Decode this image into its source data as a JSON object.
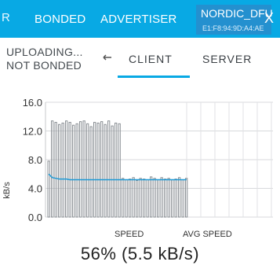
{
  "topbar": {
    "left_edge": "R",
    "tabs": [
      "BONDED",
      "ADVERTISER"
    ],
    "device_name": "NORDIC_DFU",
    "device_mac": "E1:F8:94:9D:A4:AE",
    "close": "X"
  },
  "status": {
    "line1": "UPLOADING...",
    "line2": "NOT BONDED"
  },
  "connection_tabs": {
    "client": "CLIENT",
    "server": "SERVER"
  },
  "speed_text": "56% (5.5 kB/s)",
  "chart_data": {
    "type": "bar",
    "ylabel": "kB/s",
    "ylim": [
      0,
      16
    ],
    "yticks": [
      "16.0",
      "12.0",
      "8.0",
      "4.0",
      "0.0"
    ],
    "series": [
      {
        "name": "SPEED",
        "values": [
          7.8,
          13.4,
          13.2,
          12.9,
          13.1,
          13.4,
          13.2,
          12.8,
          13.0,
          13.3,
          13.4,
          13.0,
          12.6,
          13.2,
          13.1,
          13.3,
          12.9,
          13.4,
          12.7,
          13.1,
          13.0,
          5.4,
          5.2,
          5.3,
          5.5,
          5.1,
          5.4,
          5.3,
          5.2,
          5.6,
          5.4,
          5.2,
          5.5,
          5.3,
          5.4,
          5.2,
          5.3,
          5.5,
          5.2,
          5.4
        ]
      },
      {
        "name": "AVG SPEED",
        "values": [
          6.0,
          5.5,
          5.4,
          5.3,
          5.3,
          5.3,
          5.2,
          5.2,
          5.2,
          5.2,
          5.2,
          5.2,
          5.2,
          5.2,
          5.2,
          5.2,
          5.2,
          5.2,
          5.2,
          5.2,
          5.2,
          5.2,
          5.2,
          5.2,
          5.2,
          5.2,
          5.2,
          5.2,
          5.2,
          5.2,
          5.2,
          5.2,
          5.2,
          5.2,
          5.2,
          5.2,
          5.2,
          5.2,
          5.2,
          5.2
        ]
      }
    ],
    "grid": true,
    "legend": "bottom"
  },
  "colors": {
    "primary": "#08a9e4",
    "device_bg": "#2490cf",
    "bar_stroke": "#8a8f94",
    "avg_line": "#1f9ad6"
  }
}
